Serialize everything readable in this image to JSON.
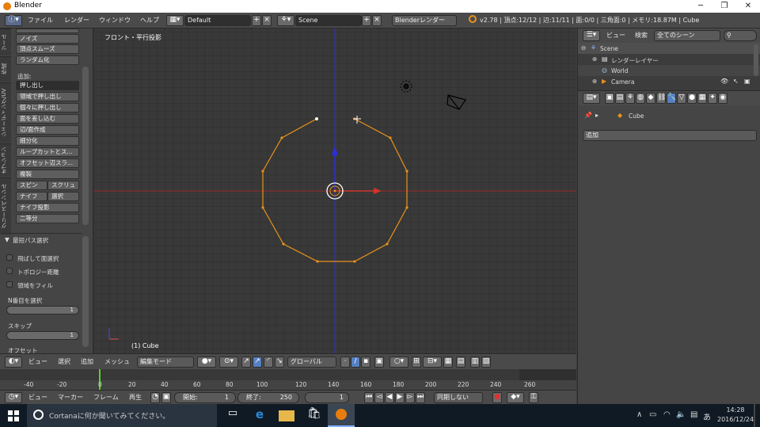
{
  "window": {
    "title": "Blender"
  },
  "topbar": {
    "menus": [
      "ファイル",
      "レンダー",
      "ウィンドウ",
      "ヘルプ"
    ],
    "layout": "Default",
    "scene": "Scene",
    "engine": "Blenderレンダー",
    "stats": "v2.78 | 頂点:12/12 | 辺:11/11 | 面:0/0 | 三角面:0 | メモリ:18.87M | Cube"
  },
  "toolshelf": {
    "tabs": [
      "ツール",
      "作成",
      "シェーディング/UV",
      "オプション",
      "グリースペンシル"
    ],
    "buttons_top": [
      "ノイズ",
      "頂点スムーズ",
      "ランダム化"
    ],
    "add_label": "追加:",
    "add_select": "押し出し",
    "add_buttons": [
      "領域で押し出し",
      "個々に押し出し",
      "面を差し込む",
      "辺/面作成",
      "細分化",
      "ループカットとス...",
      "オフセット辺スラ...",
      "複製"
    ],
    "pair1": [
      "スピン",
      "スクリュ"
    ],
    "pair2": [
      "ナイフ",
      "選択"
    ],
    "more_buttons": [
      "ナイフ投影",
      "二等分"
    ],
    "section": "最短パス選択",
    "checks": [
      "飛ばして面選択",
      "トポロジー距離",
      "領域をフィル"
    ],
    "nth_label": "N番目を選択",
    "nth_value": "1",
    "skip_label": "スキップ",
    "skip_value": "1",
    "offset_label": "オフセット"
  },
  "viewport": {
    "view_name": "フロント・平行投影",
    "object_label": "(1) Cube"
  },
  "viewheader": {
    "menus": [
      "ビュー",
      "選択",
      "追加",
      "メッシュ"
    ],
    "mode": "編集モード",
    "orientation": "グローバル"
  },
  "timeline": {
    "ticks": [
      "-40",
      "-20",
      "0",
      "20",
      "40",
      "60",
      "80",
      "100",
      "120",
      "140",
      "160",
      "180",
      "200",
      "220",
      "240",
      "260"
    ],
    "current_frame": 1
  },
  "tlbar": {
    "menus": [
      "ビュー",
      "マーカー",
      "フレーム",
      "再生"
    ],
    "start_label": "開始:",
    "start": "1",
    "end_label": "終了:",
    "end": "250",
    "current": "1",
    "sync": "同期しない"
  },
  "outliner": {
    "menus": [
      "ビュー",
      "検索"
    ],
    "filter": "全てのシーン",
    "items": [
      "Scene",
      "レンダーレイヤー",
      "World",
      "Camera"
    ]
  },
  "props": {
    "object": "Cube",
    "add_label": "追加"
  },
  "taskbar": {
    "search": "Cortanaに何か聞いてみてください。",
    "time": "14:28",
    "date": "2016/12/24"
  },
  "colors": {
    "accent": "#5680c2",
    "edge": "#e8911c",
    "xaxis": "#d0342b",
    "zaxis": "#2d2dd8"
  }
}
